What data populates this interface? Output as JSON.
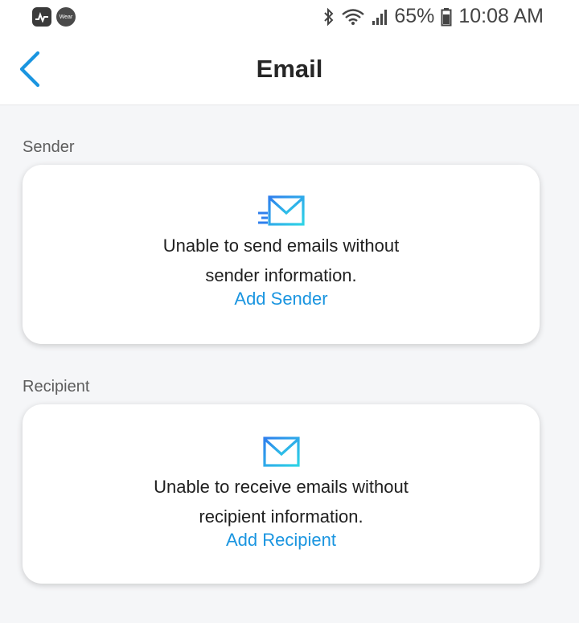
{
  "status_bar": {
    "app_icons": [
      "pulse-app-icon",
      "wear-os-icon"
    ],
    "wear_label": "Wear",
    "battery_percent": "65%",
    "time": "10:08 AM"
  },
  "header": {
    "title": "Email",
    "back_icon": "chevron-left-icon"
  },
  "sender": {
    "section_label": "Sender",
    "icon": "email-send-icon",
    "message": "Unable to send emails without sender information.",
    "link_label": "Add Sender"
  },
  "recipient": {
    "section_label": "Recipient",
    "icon": "email-icon",
    "message": "Unable to receive emails without recipient information.",
    "link_label": "Add Recipient"
  },
  "colors": {
    "accent": "#1a95e0",
    "icon_gradient_start": "#2f80ed",
    "icon_gradient_end": "#2dd4e6",
    "background": "#f5f6f8"
  }
}
